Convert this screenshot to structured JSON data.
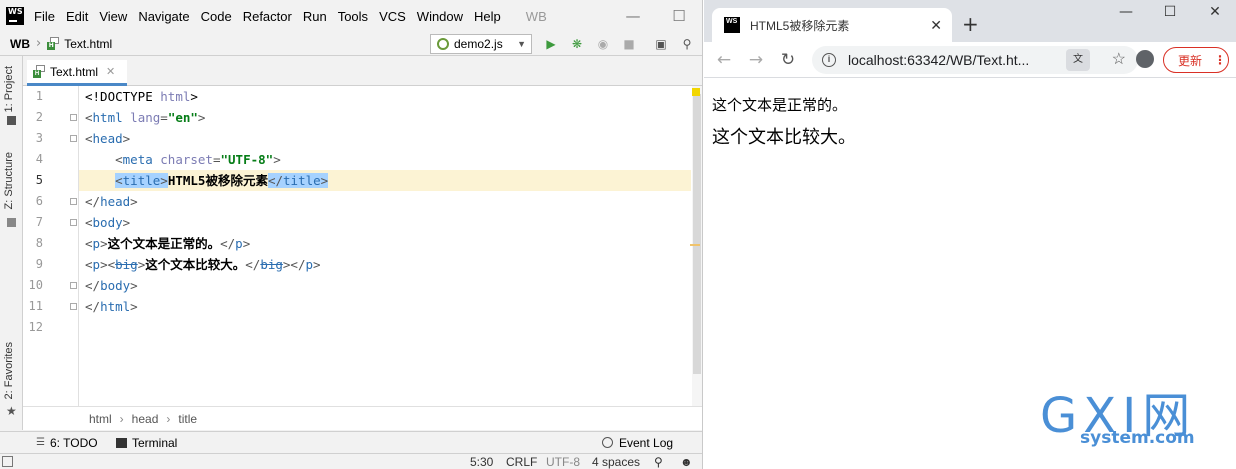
{
  "ide": {
    "app_logo": "WS",
    "menu": [
      "File",
      "Edit",
      "View",
      "Navigate",
      "Code",
      "Refactor",
      "Run",
      "Tools",
      "VCS",
      "Window",
      "Help"
    ],
    "app_name": "WB",
    "nav_project": "WB",
    "nav_file": "Text.html",
    "run_config": "demo2.js",
    "tab_label": "Text.html",
    "left_tabs": [
      "1: Project",
      "Z: Structure",
      "2: Favorites"
    ],
    "line_numbers": [
      "1",
      "2",
      "3",
      "4",
      "5",
      "6",
      "7",
      "8",
      "9",
      "10",
      "11",
      "12"
    ],
    "active_line": "5",
    "code": {
      "l1_a": "<!DOCTYPE ",
      "l1_b": "html",
      "l1_c": ">",
      "l2_tag": "html",
      "l2_attr": "lang",
      "l2_val": "\"en\"",
      "l3_tag": "head",
      "l4_tag": "meta",
      "l4_attr": "charset",
      "l4_val": "\"UTF-8\"",
      "l5_tag": "title",
      "l5_text": "HTML5被移除元素",
      "l6_tag": "head",
      "l7_tag": "body",
      "l8_tag": "p",
      "l8_text": "这个文本是正常的。",
      "l9_tag_p": "p",
      "l9_tag_big": "big",
      "l9_text": "这个文本比较大。",
      "l10_tag": "body",
      "l11_tag": "html"
    },
    "breadcrumb": [
      "html",
      "head",
      "title"
    ],
    "bottom_tools": {
      "todo": "6: TODO",
      "terminal": "Terminal",
      "event_log": "Event Log"
    },
    "status": {
      "position": "5:30",
      "line_sep": "CRLF",
      "encoding": "UTF-8",
      "indent": "4 spaces"
    }
  },
  "browser": {
    "favicon": "WS",
    "tab_title": "HTML5被移除元素",
    "url": "localhost:63342/WB/Text.ht...",
    "update_label": "更新",
    "page": {
      "p_normal": "这个文本是正常的。",
      "p_big": "这个文本比较大。"
    }
  },
  "watermark": {
    "logo": "GXI网",
    "domain": "system.com"
  },
  "colors": {
    "selection": "#a6d2ff",
    "current_line": "#fcf3d4",
    "tag_blue": "#2a6db0",
    "value_green": "#067d17",
    "attr_purple": "#7c7cb4",
    "update_red": "#d93025",
    "run_green": "#3d9a3d"
  },
  "icons": {
    "run": "play-icon",
    "debug": "bug-icon",
    "search": "search-icon",
    "star": "star-icon"
  }
}
